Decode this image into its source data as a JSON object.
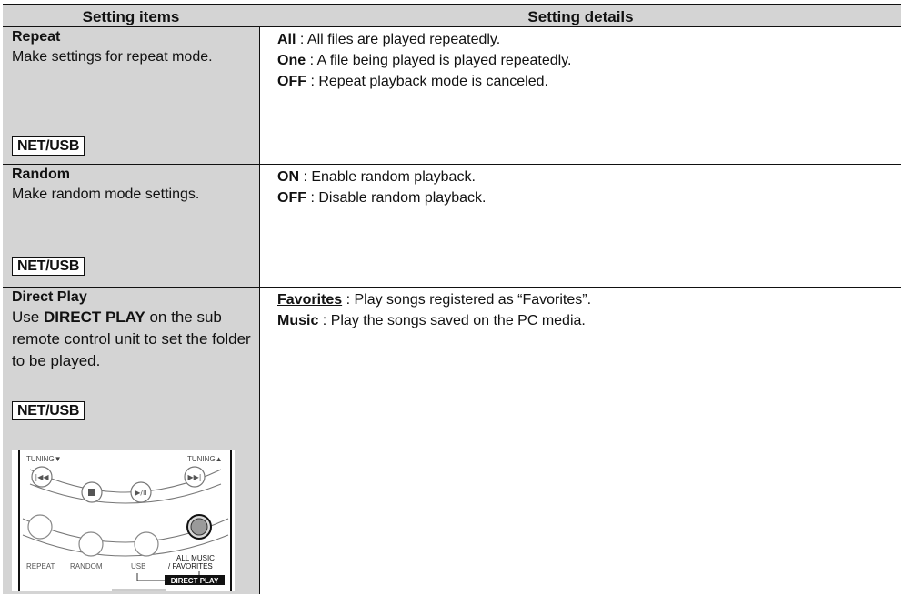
{
  "table": {
    "header": {
      "col1": "Setting items",
      "col2": "Setting details"
    },
    "rows": [
      {
        "name": "Repeat",
        "desc": "Make settings for repeat mode.",
        "badge": "NET/USB",
        "details": [
          {
            "key": "All",
            "sep": " : ",
            "text": "All files are played repeatedly."
          },
          {
            "key": "One",
            "sep": " : ",
            "text": "A file being played is played repeatedly."
          },
          {
            "key": "OFF",
            "sep": " : ",
            "text": "Repeat playback mode is canceled."
          }
        ]
      },
      {
        "name": "Random",
        "desc": "Make random mode settings.",
        "badge": "NET/USB",
        "details": [
          {
            "key": "ON",
            "sep": " : ",
            "text": "Enable random playback."
          },
          {
            "key": "OFF",
            "sep": " : ",
            "text": "Disable random playback."
          }
        ]
      },
      {
        "name": "Direct Play",
        "desc_pre": "Use ",
        "desc_key": "DIRECT PLAY",
        "desc_post": " on the sub remote control unit to set the folder to be played.",
        "badge": "NET/USB",
        "details": [
          {
            "key": "Favorites",
            "sep": " : ",
            "text": "Play songs registered as “Favorites”."
          },
          {
            "key": "Music",
            "sep": " : ",
            "text": "Play the songs saved on the PC media."
          }
        ],
        "remote": {
          "tuning_down": "TUNING▼",
          "tuning_up": "TUNING▲",
          "repeat": "REPEAT",
          "random": "RANDOM",
          "usb": "USB",
          "all_music_1": "ALL MUSIC",
          "all_music_2": "/ FAVORITES",
          "direct_play": "DIRECT PLAY"
        }
      }
    ]
  }
}
